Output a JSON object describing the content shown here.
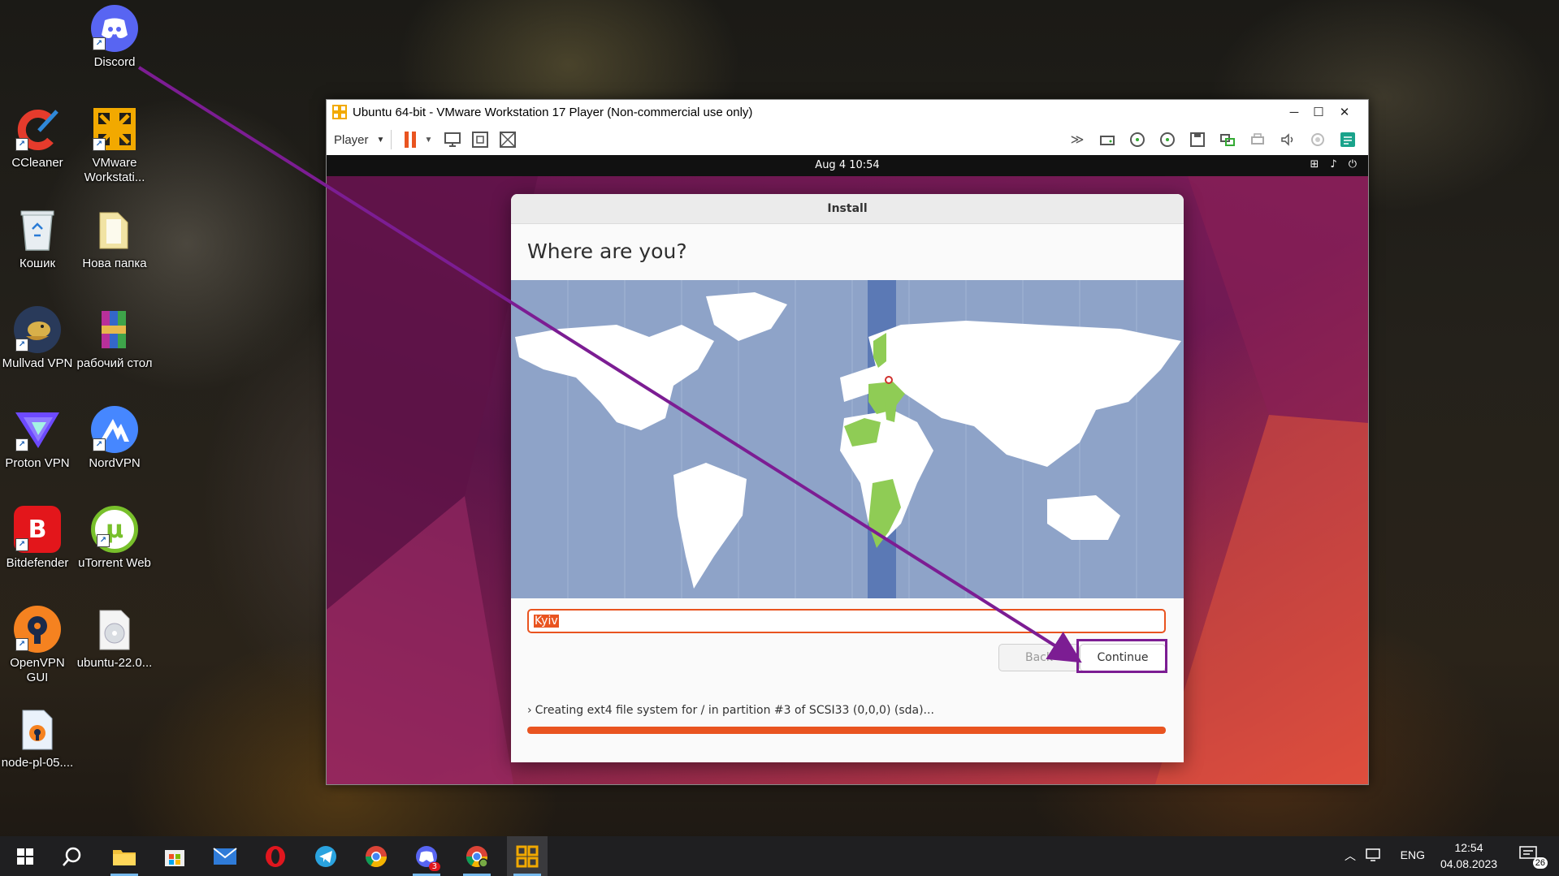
{
  "desktop": {
    "icons": [
      {
        "label": "Discord"
      },
      {
        "label": "CCleaner"
      },
      {
        "label": "VMware Workstati..."
      },
      {
        "label": "Кошик"
      },
      {
        "label": "Нова папка"
      },
      {
        "label": "Mullvad VPN"
      },
      {
        "label": "рабочий стол"
      },
      {
        "label": "Proton VPN"
      },
      {
        "label": "NordVPN"
      },
      {
        "label": "Bitdefender"
      },
      {
        "label": "uTorrent Web"
      },
      {
        "label": "OpenVPN GUI"
      },
      {
        "label": "ubuntu-22.0..."
      },
      {
        "label": "node-pl-05...."
      }
    ]
  },
  "vmware": {
    "title": "Ubuntu 64-bit - VMware Workstation 17 Player (Non-commercial use only)",
    "player_menu": "Player"
  },
  "guest": {
    "topbar_clock": "Aug 4  10:54",
    "installer": {
      "window_title": "Install",
      "heading": "Where are you?",
      "city_value": "Kyiv",
      "back_label": "Back",
      "continue_label": "Continue",
      "progress_label": "Creating ext4 file system for / in partition #3 of SCSI33 (0,0,0) (sda)...",
      "progress_fraction": 1.0,
      "accent_color": "#e95420"
    }
  },
  "taskbar": {
    "language": "ENG",
    "time": "12:54",
    "date": "04.08.2023",
    "notification_count": "26",
    "discord_badge": "3"
  }
}
